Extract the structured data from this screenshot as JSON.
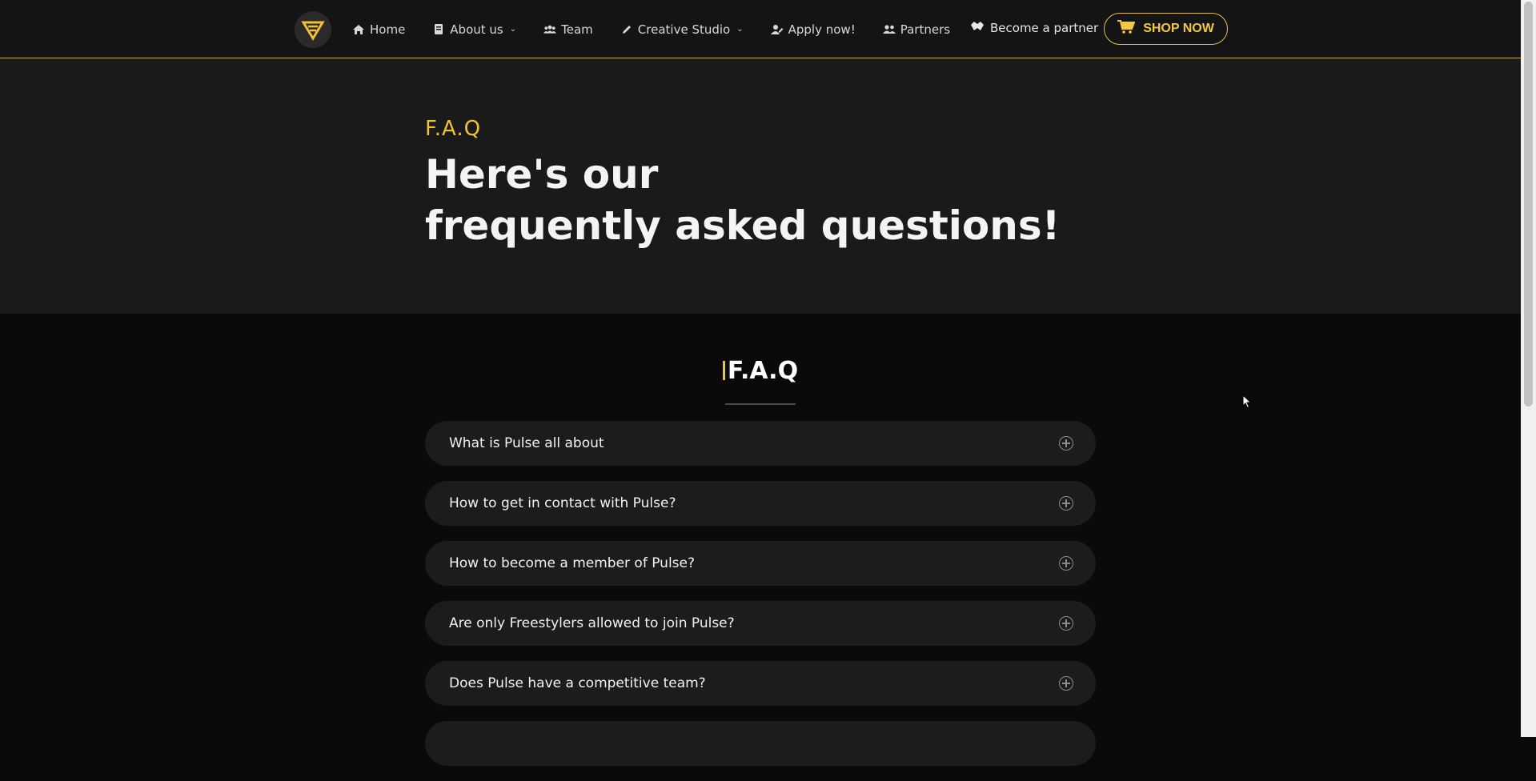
{
  "nav": {
    "items": [
      {
        "label": "Home",
        "icon": "home-icon",
        "has_dropdown": false
      },
      {
        "label": "About us",
        "icon": "document-icon",
        "has_dropdown": true
      },
      {
        "label": "Team",
        "icon": "team-icon",
        "has_dropdown": false
      },
      {
        "label": "Creative Studio",
        "icon": "pen-icon",
        "has_dropdown": true
      },
      {
        "label": "Apply now!",
        "icon": "user-edit-icon",
        "has_dropdown": false
      },
      {
        "label": "Partners",
        "icon": "users-icon",
        "has_dropdown": false
      }
    ],
    "become_partner": "Become a partner",
    "shop_now": "SHOP NOW"
  },
  "hero": {
    "kicker": "F.A.Q",
    "title_line1": "Here's our",
    "title_line2": "frequently asked questions!"
  },
  "faq": {
    "heading": "F.A.Q",
    "items": [
      "What is Pulse all about",
      "How to get in contact with Pulse?",
      "How to become a member of Pulse?",
      "Are only Freestylers allowed to join Pulse?",
      "Does Pulse have a competitive team?",
      ""
    ]
  },
  "colors": {
    "accent": "#f1c232",
    "nav_bg": "#141414",
    "hero_bg": "#1a1a1a",
    "page_bg": "#0a0a0a",
    "faq_item_bg": "#1c1c1c"
  }
}
